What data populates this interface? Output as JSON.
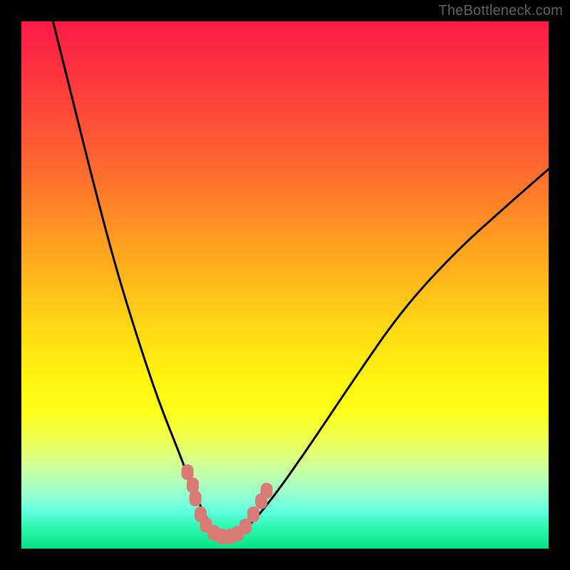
{
  "watermark": "TheBottleneck.com",
  "chart_data": {
    "type": "line",
    "title": "",
    "xlabel": "",
    "ylabel": "",
    "xlim": [
      0,
      100
    ],
    "ylim": [
      0,
      100
    ],
    "note": "Axes are unlabeled; values below are positions read off the chart in percent of the plot area (x left→right, y bottom→top). The black V-shaped curve dips to ~2% near x≈36–40 and both arms rise steeply toward the top edge. Pink capsule markers sit along the curve near the trough.",
    "series": [
      {
        "name": "bottleneck-curve-left",
        "x": [
          6,
          10,
          14,
          18,
          22,
          26,
          30,
          33,
          36,
          38
        ],
        "y": [
          100,
          84,
          68,
          53,
          40,
          28,
          18,
          10,
          4,
          2
        ]
      },
      {
        "name": "bottleneck-curve-right",
        "x": [
          40,
          43,
          48,
          55,
          63,
          72,
          82,
          92,
          100
        ],
        "y": [
          2,
          4,
          10,
          20,
          32,
          45,
          56,
          65,
          72
        ]
      }
    ],
    "markers": {
      "name": "highlight-dots",
      "color": "#d87b74",
      "points_xy_pct": [
        [
          31.5,
          14.5
        ],
        [
          32.5,
          12.0
        ],
        [
          33.0,
          9.5
        ],
        [
          34.0,
          6.5
        ],
        [
          35.0,
          4.5
        ],
        [
          36.5,
          3.0
        ],
        [
          38.0,
          2.3
        ],
        [
          39.5,
          2.3
        ],
        [
          41.0,
          2.8
        ],
        [
          42.5,
          4.2
        ],
        [
          44.0,
          6.5
        ],
        [
          45.5,
          9.0
        ],
        [
          46.5,
          11.0
        ]
      ]
    }
  }
}
